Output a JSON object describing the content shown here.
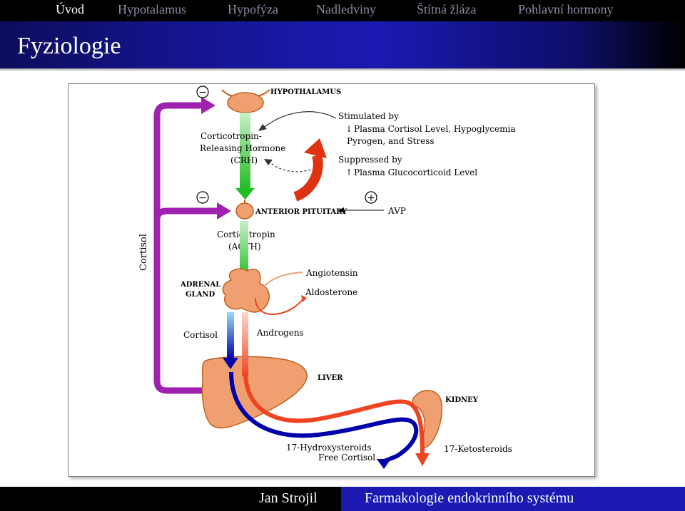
{
  "nav": {
    "items": [
      "Úvod",
      "Hypotalamus",
      "Hypofýza",
      "Nadledviny",
      "Štítná žláza",
      "Pohlavní hormony"
    ],
    "active": "Úvod"
  },
  "slide": {
    "title": "Fyziologie"
  },
  "diagram": {
    "hypothalamus": "HYPOTHALAMUS",
    "crh": [
      "Corticotropin-",
      "Releasing Hormone",
      "(CRH)"
    ],
    "stimulated_by": "Stimulated by",
    "stimulus_1": "Plasma Cortisol Level, Hypoglycemia",
    "stimulus_2": "Pyrogen, and Stress",
    "suppressed_by": "Suppressed by",
    "suppressor_1": "Plasma Glucocorticoid Level",
    "minus_sign": "−",
    "plus_sign": "+",
    "anterior_pituitary": "ANTERIOR PITUITARY",
    "avp": "AVP",
    "cortisol_vertical": "Cortisol",
    "acth": [
      "Corticotropin",
      "(ACTH)"
    ],
    "adrenal_gland": [
      "ADRENAL",
      "GLAND"
    ],
    "angiotensin": "Angiotensin",
    "aldosterone": "Aldosterone",
    "cortisol": "Cortisol",
    "androgens": "Androgens",
    "liver": "LIVER",
    "kidney": "KIDNEY",
    "hydroxysteroids": [
      "17-Hydroxysteroids",
      "Free Cortisol"
    ],
    "ketosteroids": "17-Ketosteroids"
  },
  "colors": {
    "feedback_purple": "#a020b0",
    "releasing_green": "#33cc33",
    "organ_peach": "#f0a070",
    "cortisol_blue": "#0000aa",
    "androgen_red": "#ee4422"
  },
  "footer": {
    "author": "Jan Strojil",
    "course": "Farmakologie endokrinního systému"
  }
}
